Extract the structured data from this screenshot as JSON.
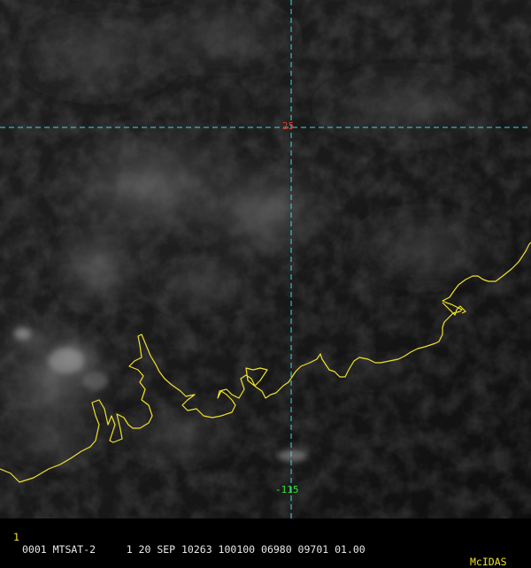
{
  "window": {
    "frame_number": "1",
    "info_text": "0001 MTSAT-2     1 20 SEP 10263 100100 06980 09701 01.00",
    "brand": "McIDAS"
  },
  "grid": {
    "latitude_label": "25",
    "longitude_label": "-115"
  },
  "colors": {
    "background": "#000000",
    "coastline": "#f0e02a",
    "gridline": "#40d8e0",
    "latitude_label": "#e23a2a",
    "longitude_label": "#36e036",
    "frame_number": "#f0e02a",
    "info_text": "#e8e8e8",
    "brand": "#f0e02a"
  },
  "icons": {
    "image_view": "satellite-visible-imagery"
  }
}
